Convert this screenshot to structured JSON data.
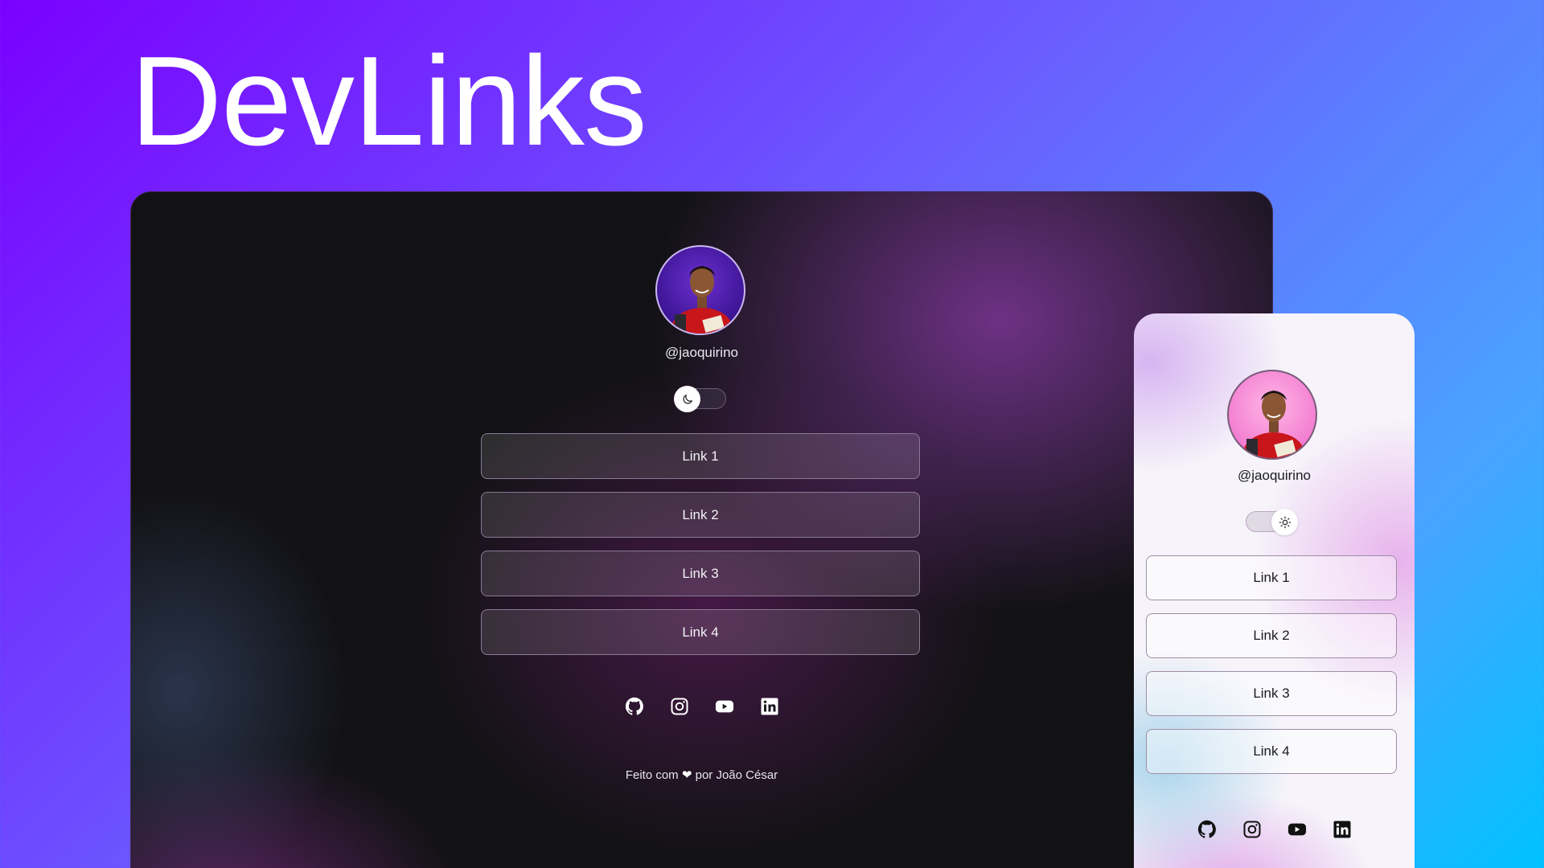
{
  "hero": {
    "title": "DevLinks"
  },
  "desktop": {
    "handle": "@jaoquirino",
    "theme": "dark",
    "toggle_icon": "moon-icon",
    "links": [
      {
        "label": "Link 1"
      },
      {
        "label": "Link 2"
      },
      {
        "label": "Link 3"
      },
      {
        "label": "Link 4"
      }
    ],
    "social": [
      "github-icon",
      "instagram-icon",
      "youtube-icon",
      "linkedin-icon"
    ],
    "footer": {
      "prefix": "Feito com",
      "heart": "❤",
      "suffix": "por João César"
    }
  },
  "mobile": {
    "handle": "@jaoquirino",
    "theme": "light",
    "toggle_icon": "sun-icon",
    "links": [
      {
        "label": "Link 1"
      },
      {
        "label": "Link 2"
      },
      {
        "label": "Link 3"
      },
      {
        "label": "Link 4"
      }
    ],
    "social": [
      "github-icon",
      "instagram-icon",
      "youtube-icon",
      "linkedin-icon"
    ]
  },
  "colors": {
    "background_start": "#7a00ff",
    "background_end": "#00c2ff",
    "dark_surface": "#121215",
    "light_surface": "#f6f4fa"
  }
}
